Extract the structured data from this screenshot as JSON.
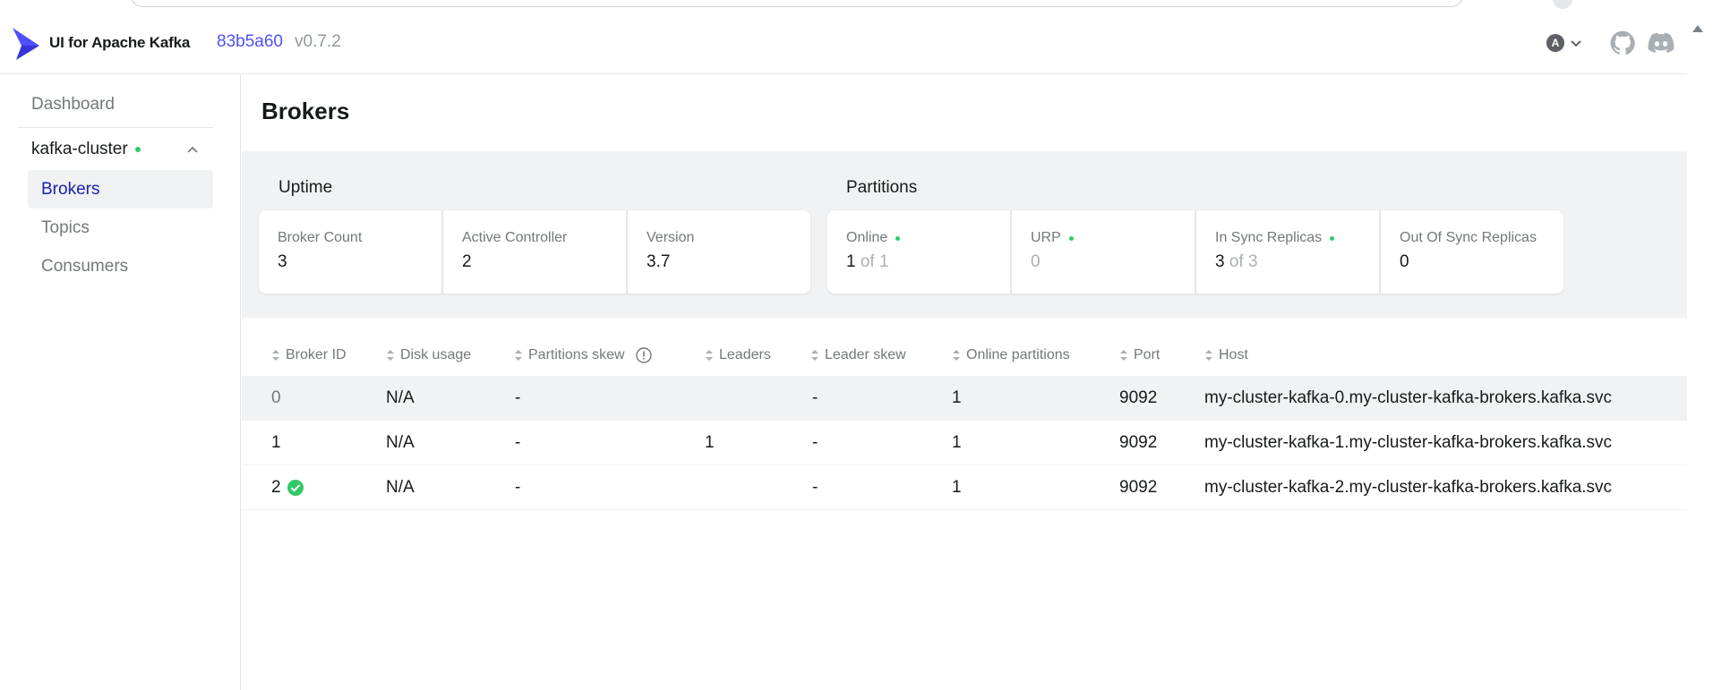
{
  "header": {
    "app_name": "UI for Apache Kafka",
    "version_hash": "83b5a60",
    "version_tag": "v0.7.2",
    "user_initial": "A"
  },
  "sidebar": {
    "dashboard": "Dashboard",
    "cluster_name": "kafka-cluster",
    "items": [
      {
        "label": "Brokers",
        "active": true
      },
      {
        "label": "Topics",
        "active": false
      },
      {
        "label": "Consumers",
        "active": false
      }
    ]
  },
  "page": {
    "title": "Brokers"
  },
  "uptime": {
    "title": "Uptime",
    "metrics": [
      {
        "label": "Broker Count",
        "value": "3"
      },
      {
        "label": "Active Controller",
        "value": "2"
      },
      {
        "label": "Version",
        "value": "3.7"
      }
    ]
  },
  "partitions": {
    "title": "Partitions",
    "metrics": [
      {
        "label": "Online",
        "value": "1",
        "suffix": "of 1"
      },
      {
        "label": "URP",
        "value": "0"
      },
      {
        "label": "In Sync Replicas",
        "value": "3",
        "suffix": "of 3"
      },
      {
        "label": "Out Of Sync Replicas",
        "value": "0"
      }
    ]
  },
  "table": {
    "columns": [
      "Broker ID",
      "Disk usage",
      "Partitions skew",
      "Leaders",
      "Leader skew",
      "Online partitions",
      "Port",
      "Host"
    ],
    "rows": [
      {
        "id": "0",
        "disk": "N/A",
        "pskew": "-",
        "leaders": "",
        "lskew": "-",
        "online": "1",
        "port": "9092",
        "host": "my-cluster-kafka-0.my-cluster-kafka-brokers.kafka.svc"
      },
      {
        "id": "1",
        "disk": "N/A",
        "pskew": "-",
        "leaders": "1",
        "lskew": "-",
        "online": "1",
        "port": "9092",
        "host": "my-cluster-kafka-1.my-cluster-kafka-brokers.kafka.svc"
      },
      {
        "id": "2",
        "disk": "N/A",
        "pskew": "-",
        "leaders": "",
        "lskew": "-",
        "online": "1",
        "port": "9092",
        "host": "my-cluster-kafka-2.my-cluster-kafka-brokers.kafka.svc"
      }
    ]
  },
  "colors": {
    "accent": "#4f4ffe",
    "active_nav": "#1d21aa",
    "online_dot": "#30c966"
  }
}
